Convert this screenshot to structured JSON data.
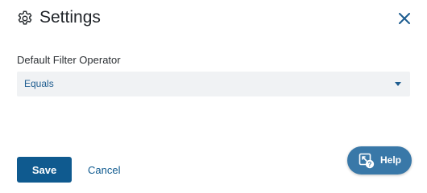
{
  "header": {
    "title": "Settings",
    "icon": "gear-icon",
    "close_icon": "close-icon"
  },
  "form": {
    "default_filter_operator": {
      "label": "Default Filter Operator",
      "value": "Equals"
    }
  },
  "actions": {
    "save_label": "Save",
    "cancel_label": "Cancel"
  },
  "help": {
    "label": "Help",
    "icon": "help-icon"
  },
  "colors": {
    "primary": "#0f5a8f",
    "help_bg": "#3978a8",
    "select_bg": "#f0f2f4",
    "select_text": "#1d5c8f"
  }
}
